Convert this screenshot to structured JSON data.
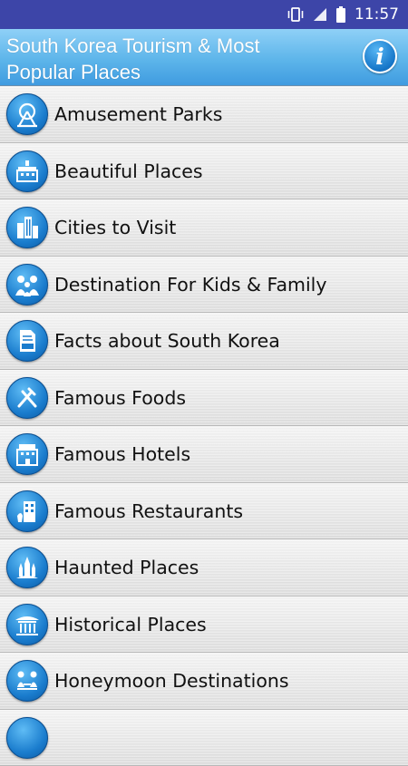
{
  "status": {
    "time": "11:57"
  },
  "header": {
    "title": "South Korea Tourism & Most Popular Places",
    "info_icon": "info-icon",
    "info_glyph": "i"
  },
  "colors": {
    "status_bar": "#3d45a8",
    "header": "#5db5ea",
    "icon_blue": "#1a7ccd"
  },
  "items": [
    {
      "label": "Amusement Parks",
      "icon": "ferris-wheel-icon"
    },
    {
      "label": "Beautiful Places",
      "icon": "palace-icon"
    },
    {
      "label": "Cities to Visit",
      "icon": "city-icon"
    },
    {
      "label": "Destination For Kids & Family",
      "icon": "family-icon"
    },
    {
      "label": "Facts about South Korea",
      "icon": "fact-document-icon"
    },
    {
      "label": "Famous Foods",
      "icon": "fork-knife-icon"
    },
    {
      "label": "Famous Hotels",
      "icon": "hotel-icon"
    },
    {
      "label": "Famous Restaurants",
      "icon": "restaurant-icon"
    },
    {
      "label": "Haunted Places",
      "icon": "haunted-castle-icon"
    },
    {
      "label": "Historical Places",
      "icon": "temple-icon"
    },
    {
      "label": "Honeymoon Destinations",
      "icon": "couple-icon"
    },
    {
      "label": "",
      "icon": "list-item-icon"
    }
  ]
}
